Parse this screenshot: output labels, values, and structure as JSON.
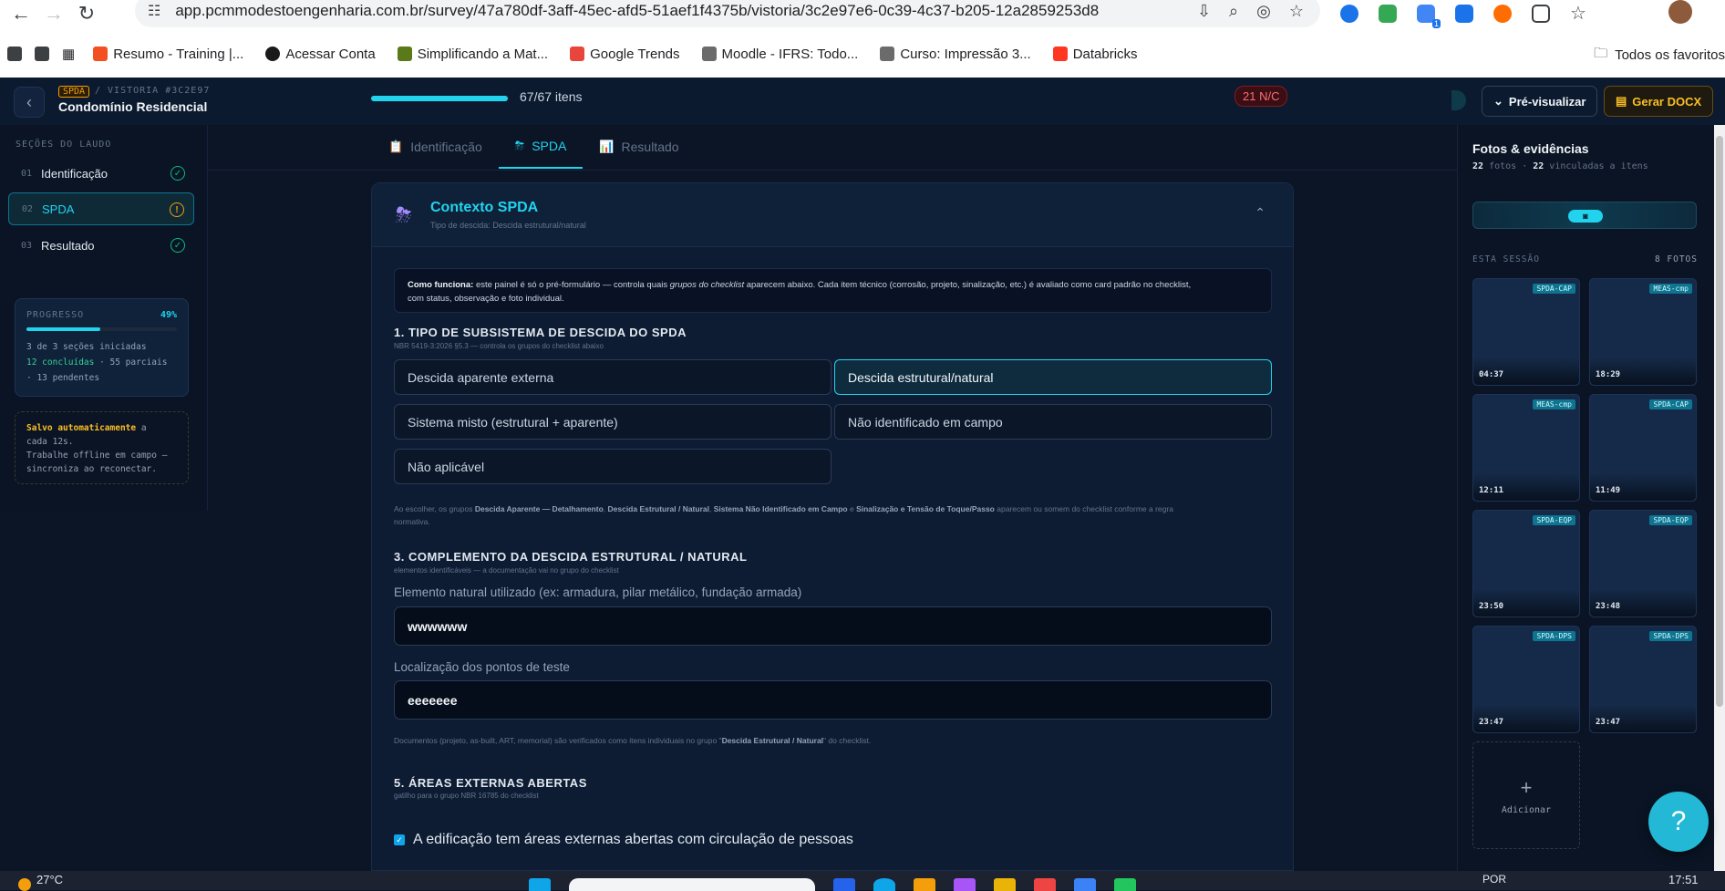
{
  "browser": {
    "url": "app.pcmmodestoengenharia.com.br/survey/47a780df-3aff-45ec-afd5-51aef1f4375b/vistoria/3c2e97e6-0c39-4c37-b205-12a2859253d8",
    "ext_badge": "1",
    "bookmarks": [
      {
        "label": "Resumo - Training |...",
        "color": "#f25022"
      },
      {
        "label": "Acessar Conta",
        "color": "#1a1a1a"
      },
      {
        "label": "Simplificando a Mat...",
        "color": "#5a7a1a"
      },
      {
        "label": "Google Trends",
        "color": "#e8453c"
      },
      {
        "label": "Moodle - IFRS: Todo...",
        "color": "#6b6b6b"
      },
      {
        "label": "Curso: Impressão 3...",
        "color": "#6b6b6b"
      },
      {
        "label": "Databricks",
        "color": "#ff3621"
      }
    ],
    "bookmarks_all": "Todos os favoritos"
  },
  "header": {
    "tag": "SPDA",
    "vistoria": "/ VISTORIA #3C2E97",
    "condo": "Condomínio Residencial A",
    "progress_fraction": 1.0,
    "progress_text": "67/67 itens",
    "nc_badge": "21 N/C",
    "preview_label": "Pré-visualizar",
    "docx_label": "Gerar DOCX"
  },
  "sidebar": {
    "title": "SEÇÕES DO LAUDO",
    "items": [
      {
        "num": "01",
        "label": "Identificação",
        "status": "done"
      },
      {
        "num": "02",
        "label": "SPDA",
        "status": "warn"
      },
      {
        "num": "03",
        "label": "Resultado",
        "status": "done"
      }
    ],
    "progress": {
      "title": "PROGRESSO",
      "pct": "49%",
      "fraction": 0.49,
      "line1": "3 de 3 seções iniciadas",
      "done": "12 concluídas",
      "partial": " · 55 parciais",
      "pending": "· 13 pendentes"
    },
    "save": {
      "strong": "Salvo automaticamente",
      "rest1": " a",
      "line2": "cada 12s.",
      "line3": "Trabalhe offline em campo —",
      "line4": "sincroniza ao reconectar."
    }
  },
  "tabs": [
    {
      "icon": "📋",
      "label": "Identificação"
    },
    {
      "icon": "⛈",
      "label": "SPDA"
    },
    {
      "icon": "📊",
      "label": "Resultado"
    }
  ],
  "card": {
    "title": "Contexto SPDA",
    "subtitle": "Tipo de descida: Descida estrutural/natural",
    "info_strong": "Como funciona:",
    "info_1": " este painel é só o pré-formulário — controla quais ",
    "info_em": "grupos do checklist",
    "info_2": " aparecem abaixo. Cada item técnico (corrosão, projeto, sinalização, etc.) é avaliado como card padrão no checklist,",
    "info_3": "com status, observação e foto individual.",
    "sec1_title": "1. TIPO DE SUBSISTEMA DE DESCIDA DO SPDA",
    "sec1_sub": "NBR 5419-3:2026 §5.3 — controla os grupos do checklist abaixo",
    "options": [
      "Descida aparente externa",
      "Descida estrutural/natural",
      "Sistema misto (estrutural + aparente)",
      "Não identificado em campo",
      "Não aplicável"
    ],
    "selected_option": "Descida estrutural/natural",
    "note1_a": "Ao escolher, os grupos ",
    "note1_b1": "Descida Aparente — Detalhamento",
    "note1_c1": ", ",
    "note1_b2": "Descida Estrutural / Natural",
    "note1_c2": ", ",
    "note1_b3": "Sistema Não Identificado em Campo",
    "note1_c3": " e ",
    "note1_b4": "Sinalização e Tensão de Toque/Passo",
    "note1_d": " aparecem ou somem do checklist conforme a regra",
    "note1_e": "normativa.",
    "sec3_title": "3. COMPLEMENTO DA DESCIDA ESTRUTURAL / NATURAL",
    "sec3_sub": "elementos identificáveis — a documentação vai no grupo do checklist",
    "field1_label": "Elemento natural utilizado (ex: armadura, pilar metálico, fundação armada)",
    "field1_value": "wwwwww",
    "field2_label": "Localização dos pontos de teste",
    "field2_value": "eeeeeee",
    "note2_a": "Documentos (projeto, as-built, ART, memorial) são verificados como itens individuais no grupo \"",
    "note2_b": "Descida Estrutural / Natural",
    "note2_c": "\" do checklist.",
    "sec5_title": "5. ÁREAS EXTERNAS ABERTAS",
    "sec5_sub": "gatilho para o grupo NBR 16785 do checklist",
    "checkbox_label": "A edificação tem áreas externas abertas com circulação de pessoas",
    "checkbox_checked": true
  },
  "photos": {
    "title": "Fotos & evidências",
    "count": "22",
    "count_label": " fotos · ",
    "linked": "22",
    "linked_label": " vinculadas a itens",
    "session_label": "ESTA SESSÃO",
    "session_count": "8 FOTOS",
    "items": [
      {
        "tag": "SPDA-CAP",
        "time": "04:37"
      },
      {
        "tag": "MEAS-cmp",
        "time": "18:29"
      },
      {
        "tag": "MEAS-cmp",
        "time": "12:11"
      },
      {
        "tag": "SPDA-CAP",
        "time": "11:49"
      },
      {
        "tag": "SPDA-EQP",
        "time": "23:50"
      },
      {
        "tag": "SPDA-EQP",
        "time": "23:48"
      },
      {
        "tag": "SPDA-DPS",
        "time": "23:47"
      },
      {
        "tag": "SPDA-DPS",
        "time": "23:47"
      }
    ],
    "add_label": "Adicionar"
  },
  "taskbar": {
    "temp": "27°C",
    "lang": "POR",
    "time": "17:51"
  },
  "colors": {
    "accent": "#22d3ee",
    "warning": "#f59e0b",
    "success": "#10b981",
    "danger": "#f87171",
    "background": "#0b1526"
  }
}
